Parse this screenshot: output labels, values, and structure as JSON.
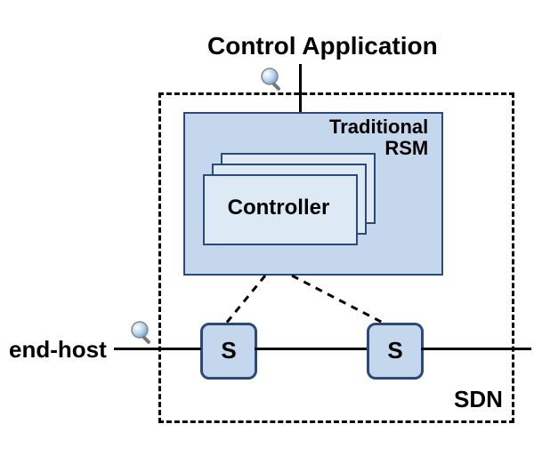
{
  "title": "Control Application",
  "end_host": "end-host",
  "rsm": {
    "line1": "Traditional",
    "line2": "RSM"
  },
  "controller": "Controller",
  "switch_label": "S",
  "sdn_label": "SDN"
}
